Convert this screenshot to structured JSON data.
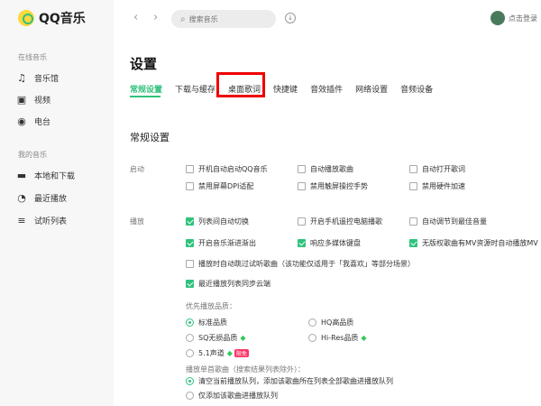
{
  "app": {
    "title": "QQ音乐"
  },
  "sidebar": {
    "online_section": "在线音乐",
    "online_items": [
      {
        "label": "音乐馆",
        "icon": "music-note-icon"
      },
      {
        "label": "视频",
        "icon": "video-icon"
      },
      {
        "label": "电台",
        "icon": "radio-icon"
      }
    ],
    "mine_section": "我的音乐",
    "mine_items": [
      {
        "label": "本地和下载",
        "icon": "computer-icon"
      },
      {
        "label": "最近播放",
        "icon": "clock-icon"
      },
      {
        "label": "试听列表",
        "icon": "playlist-icon"
      }
    ]
  },
  "topbar": {
    "search_placeholder": "搜索音乐",
    "login_text": "点击登录"
  },
  "page": {
    "title": "设置",
    "tabs": [
      "常规设置",
      "下载与缓存",
      "桌面歌词",
      "快捷键",
      "音效插件",
      "网络设置",
      "音频设备"
    ],
    "active_tab": "常规设置",
    "highlighted_tab": "桌面歌词"
  },
  "settings": {
    "section_title": "常规设置",
    "startup": {
      "label": "启动",
      "options": [
        {
          "label": "开机自动启动QQ音乐",
          "checked": false
        },
        {
          "label": "自动播放歌曲",
          "checked": false
        },
        {
          "label": "自动打开歌词",
          "checked": false
        },
        {
          "label": "禁用屏幕DPI适配",
          "checked": false
        },
        {
          "label": "禁用触屏操控手势",
          "checked": false
        },
        {
          "label": "禁用硬件加速",
          "checked": false
        }
      ]
    },
    "playback": {
      "label": "播放",
      "options": [
        {
          "label": "列表间自动切换",
          "checked": true
        },
        {
          "label": "开启手机遥控电脑播歌",
          "checked": false
        },
        {
          "label": "自动调节到最佳音量",
          "checked": false
        },
        {
          "label": "开启音乐渐进渐出",
          "checked": true
        },
        {
          "label": "响应多媒体键盘",
          "checked": true
        },
        {
          "label": "无版权歌曲有MV资源时自动播放MV",
          "checked": true
        },
        {
          "label": "播放时自动跳过试听歌曲（该功能仅适用于「我喜欢」等部分场景）",
          "checked": false
        },
        {
          "label": "最近播放列表同步云端",
          "checked": true
        }
      ]
    },
    "quality": {
      "label": "优先播放品质：",
      "options": [
        {
          "label": "标准品质",
          "selected": true
        },
        {
          "label": "HQ高品质",
          "selected": false
        },
        {
          "label": "SQ无损品质",
          "selected": false
        },
        {
          "label": "Hi-Res品质",
          "selected": false
        },
        {
          "label": "5.1声道",
          "selected": false
        }
      ],
      "limited_badge": "限免"
    },
    "single_song": {
      "label": "播放单首歌曲（搜索结果列表除外）：",
      "options": [
        {
          "label": "清空当前播放队列，添加该歌曲所在列表全部歌曲进播放队列",
          "selected": true
        },
        {
          "label": "仅添加该歌曲进播放队列",
          "selected": false
        }
      ]
    }
  },
  "colors": {
    "accent": "#31c27c",
    "highlight": "#ee0000"
  }
}
